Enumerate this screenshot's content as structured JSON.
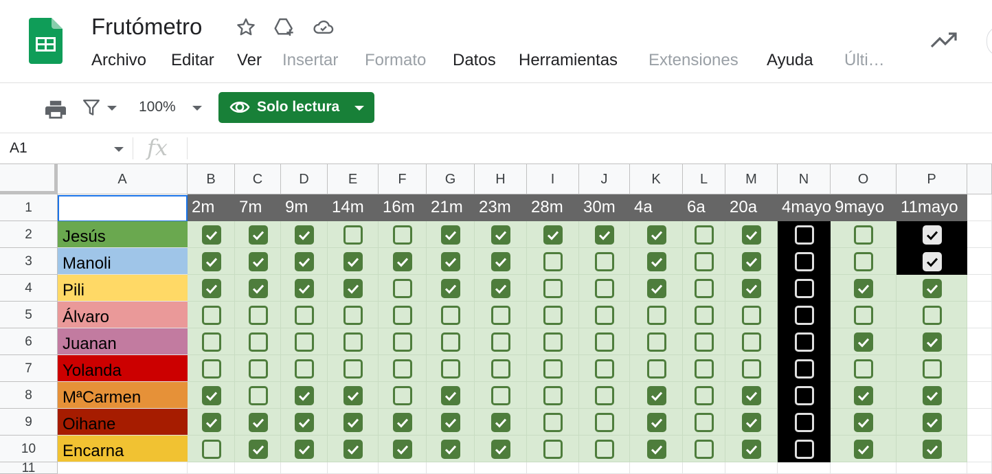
{
  "app": {
    "title": "Frutómetro",
    "menu": [
      {
        "label": "Archivo",
        "disabled": false
      },
      {
        "label": "Editar",
        "disabled": false
      },
      {
        "label": "Ver",
        "disabled": false
      },
      {
        "label": "Insertar",
        "disabled": true
      },
      {
        "label": "Formato",
        "disabled": true
      },
      {
        "label": "Datos",
        "disabled": false
      },
      {
        "label": "Herramientas",
        "disabled": false
      },
      {
        "label": "Extensiones",
        "disabled": true
      },
      {
        "label": "Ayuda",
        "disabled": false
      },
      {
        "label": "Últi…",
        "disabled": true
      }
    ]
  },
  "toolbar": {
    "zoom": "100%",
    "mode_label": "Solo lectura"
  },
  "formula_bar": {
    "name_box": "A1",
    "fx": "fx"
  },
  "colors": {
    "header_bg": "#666666",
    "cell_green": "#d9ead3",
    "check_green": "#4e7d3c",
    "black_col": "#000000",
    "readonly_button": "#188038"
  },
  "sheet": {
    "column_letters": [
      "A",
      "B",
      "C",
      "D",
      "E",
      "F",
      "G",
      "H",
      "I",
      "J",
      "K",
      "L",
      "M",
      "N",
      "O",
      "P"
    ],
    "row_numbers": [
      "1",
      "2",
      "3",
      "4",
      "5",
      "6",
      "7",
      "8",
      "9",
      "10",
      "11"
    ],
    "header_row": [
      "",
      "2m",
      "7m",
      "9m",
      "14m",
      "16m",
      "21m",
      "23m",
      "28m",
      "30m",
      "4a",
      "6a",
      "20a",
      "4mayo",
      "9mayo",
      "11mayo"
    ],
    "people": [
      {
        "name": "Jesús",
        "bg": "#6aa84f",
        "color": "#000000",
        "checks": [
          1,
          1,
          1,
          0,
          0,
          1,
          1,
          1,
          1,
          1,
          0,
          1,
          0,
          0,
          1
        ]
      },
      {
        "name": "Manoli",
        "bg": "#9fc5e8",
        "color": "#000000",
        "checks": [
          1,
          1,
          1,
          1,
          1,
          1,
          1,
          0,
          0,
          1,
          0,
          1,
          0,
          0,
          1
        ]
      },
      {
        "name": "Pili",
        "bg": "#ffd966",
        "color": "#000000",
        "checks": [
          1,
          1,
          1,
          1,
          0,
          1,
          1,
          0,
          0,
          1,
          0,
          1,
          0,
          1,
          1
        ]
      },
      {
        "name": "Álvaro",
        "bg": "#ea9999",
        "color": "#000000",
        "checks": [
          0,
          0,
          0,
          0,
          0,
          0,
          0,
          0,
          0,
          0,
          0,
          0,
          0,
          0,
          0
        ]
      },
      {
        "name": "Juanan",
        "bg": "#c27ba0",
        "color": "#000000",
        "checks": [
          0,
          0,
          0,
          0,
          0,
          0,
          0,
          0,
          0,
          0,
          0,
          0,
          0,
          1,
          1
        ]
      },
      {
        "name": "Yolanda",
        "bg": "#cc0000",
        "color": "#000000",
        "checks": [
          0,
          0,
          0,
          0,
          0,
          0,
          0,
          0,
          0,
          0,
          0,
          0,
          0,
          0,
          0
        ]
      },
      {
        "name": "MªCarmen",
        "bg": "#e69138",
        "color": "#000000",
        "checks": [
          1,
          0,
          1,
          1,
          0,
          1,
          0,
          0,
          0,
          1,
          0,
          1,
          0,
          1,
          1
        ]
      },
      {
        "name": "Oihane",
        "bg": "#a61c00",
        "color": "#000000",
        "checks": [
          1,
          1,
          1,
          1,
          1,
          1,
          1,
          0,
          0,
          1,
          0,
          1,
          0,
          1,
          1
        ]
      },
      {
        "name": "Encarna",
        "bg": "#f1c232",
        "color": "#000000",
        "checks": [
          0,
          1,
          1,
          1,
          1,
          1,
          1,
          0,
          0,
          1,
          0,
          1,
          0,
          1,
          1
        ]
      }
    ]
  }
}
